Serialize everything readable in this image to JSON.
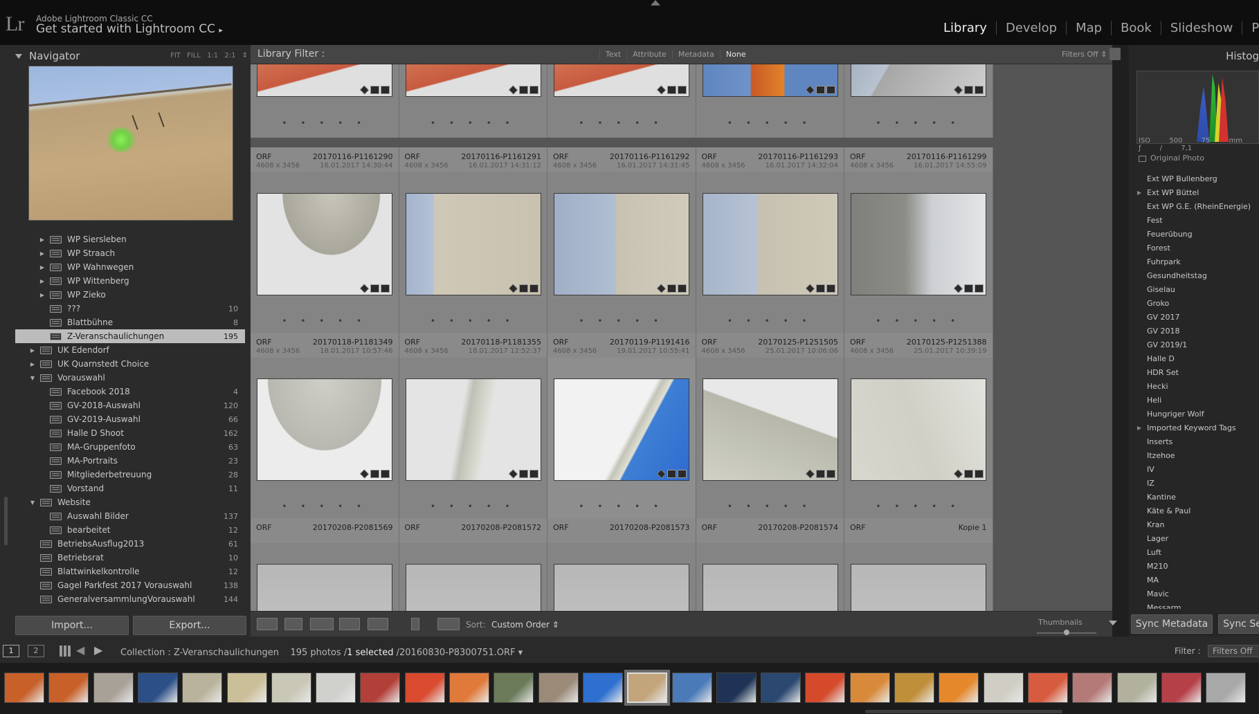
{
  "identity": {
    "app_name": "Adobe Lightroom Classic CC",
    "tagline": "Get started with Lightroom CC",
    "tagline_arrow": "▸",
    "logo": "Lr"
  },
  "modules": [
    "Library",
    "Develop",
    "Map",
    "Book",
    "Slideshow",
    "Prin"
  ],
  "active_module": "Library",
  "navigator": {
    "title": "Navigator",
    "options": "FIT FILL 1:1 2:1 ⇕"
  },
  "collections": [
    {
      "name": "WP Siersleben",
      "count": "",
      "level": 2,
      "expander": "▶"
    },
    {
      "name": "WP Straach",
      "count": "",
      "level": 2,
      "expander": "▶"
    },
    {
      "name": "WP Wahnwegen",
      "count": "",
      "level": 2,
      "expander": "▶"
    },
    {
      "name": "WP Wittenberg",
      "count": "",
      "level": 2,
      "expander": "▶"
    },
    {
      "name": "WP Zieko",
      "count": "",
      "level": 2,
      "expander": "▶"
    },
    {
      "name": "???",
      "count": "10",
      "level": 2,
      "expander": ""
    },
    {
      "name": "Blattbühne",
      "count": "8",
      "level": 2,
      "expander": ""
    },
    {
      "name": "Z-Veranschaulichungen",
      "count": "195",
      "level": 2,
      "expander": "",
      "selected": true
    },
    {
      "name": "UK Edendorf",
      "count": "",
      "level": 1,
      "expander": "▶"
    },
    {
      "name": "UK Quarnstedt Choice",
      "count": "",
      "level": 1,
      "expander": "▶"
    },
    {
      "name": "Vorauswahl",
      "count": "",
      "level": 1,
      "expander": "▼"
    },
    {
      "name": "Facebook 2018",
      "count": "4",
      "level": 2,
      "expander": ""
    },
    {
      "name": "GV-2018-Auswahl",
      "count": "120",
      "level": 2,
      "expander": ""
    },
    {
      "name": "GV-2019-Auswahl",
      "count": "66",
      "level": 2,
      "expander": ""
    },
    {
      "name": "Halle D Shoot",
      "count": "162",
      "level": 2,
      "expander": ""
    },
    {
      "name": "MA-Gruppenfoto",
      "count": "63",
      "level": 2,
      "expander": ""
    },
    {
      "name": "MA-Portraits",
      "count": "23",
      "level": 2,
      "expander": ""
    },
    {
      "name": "Mitgliederbetreuung",
      "count": "28",
      "level": 2,
      "expander": ""
    },
    {
      "name": "Vorstand",
      "count": "11",
      "level": 2,
      "expander": ""
    },
    {
      "name": "Website",
      "count": "",
      "level": 1,
      "expander": "▼"
    },
    {
      "name": "Auswahl Bilder",
      "count": "137",
      "level": 2,
      "expander": ""
    },
    {
      "name": "bearbeitet",
      "count": "12",
      "level": 2,
      "expander": ""
    },
    {
      "name": "BetriebsAusflug2013",
      "count": "61",
      "level": 1,
      "expander": ""
    },
    {
      "name": "Betriebsrat",
      "count": "10",
      "level": 1,
      "expander": ""
    },
    {
      "name": "Blattwinkelkontrolle",
      "count": "12",
      "level": 1,
      "expander": ""
    },
    {
      "name": "Gagel Parkfest 2017 Vorauswahl",
      "count": "138",
      "level": 1,
      "expander": ""
    },
    {
      "name": "GeneralversammlungVorauswahl",
      "count": "144",
      "level": 1,
      "expander": ""
    }
  ],
  "buttons": {
    "import": "Import...",
    "export": "Export...",
    "sync_metadata": "Sync Metadata",
    "sync_settings": "Sync Se"
  },
  "library_filter": {
    "label": "Library Filter :",
    "options": [
      "Text",
      "Attribute",
      "Metadata",
      "None"
    ],
    "active": "None",
    "filters_state": "Filters Off ⇕"
  },
  "grid": {
    "partial_row": [
      {
        "thumb": "t-orange"
      },
      {
        "thumb": "t-orange"
      },
      {
        "thumb": "t-orange"
      },
      {
        "thumb": "t-blueorange"
      },
      {
        "thumb": "t-greyblade"
      }
    ],
    "rows": [
      [
        {
          "ext": "ORF",
          "file": "20170116-P1161290",
          "dims": "4608 x 3456",
          "date": "16.01.2017 14:30:44",
          "thumb": "t-bladetip"
        },
        {
          "ext": "ORF",
          "file": "20170116-P1161291",
          "dims": "4608 x 3456",
          "date": "16.01.2017 14:31:12",
          "thumb": "t-bladeside"
        },
        {
          "ext": "ORF",
          "file": "20170116-P1161292",
          "dims": "4608 x 3456",
          "date": "16.01.2017 14:31:45",
          "thumb": "t-bladeside2"
        },
        {
          "ext": "ORF",
          "file": "20170116-P1161293",
          "dims": "4608 x 3456",
          "date": "16.01.2017 14:32:04",
          "thumb": "t-bladeside3"
        },
        {
          "ext": "ORF",
          "file": "20170116-P1161299",
          "dims": "4608 x 3456",
          "date": "16.01.2017 14:55:09",
          "thumb": "t-bladegrey"
        }
      ],
      [
        {
          "ext": "ORF",
          "file": "20170118-P1181349",
          "dims": "4608 x 3456",
          "date": "18.01.2017 10:57:46",
          "thumb": "t-bladetipdark"
        },
        {
          "ext": "ORF",
          "file": "20170118-P1181355",
          "dims": "4608 x 3456",
          "date": "18.01.2017 12:52:37",
          "thumb": "t-rod"
        },
        {
          "ext": "ORF",
          "file": "20170119-P1191416",
          "dims": "4608 x 3456",
          "date": "19.01.2017 10:55:41",
          "thumb": "t-rodblue"
        },
        {
          "ext": "ORF",
          "file": "20170125-P1251505",
          "dims": "4608 x 3456",
          "date": "25.01.2017 10:06:06",
          "thumb": "t-bladewide"
        },
        {
          "ext": "ORF",
          "file": "20170125-P1251388",
          "dims": "4608 x 3456",
          "date": "25.01.2017 10:39:19",
          "thumb": "t-bladepale"
        }
      ],
      [
        {
          "ext": "ORF",
          "file": "20170208-P2081569",
          "dims": "",
          "date": "",
          "thumb": "t-dark"
        },
        {
          "ext": "ORF",
          "file": "20170208-P2081572",
          "dims": "",
          "date": "",
          "thumb": "t-dark"
        },
        {
          "ext": "ORF",
          "file": "20170208-P2081573",
          "dims": "",
          "date": "",
          "thumb": "t-dark"
        },
        {
          "ext": "ORF",
          "file": "20170208-P2081574",
          "dims": "",
          "date": "",
          "thumb": "t-dark"
        },
        {
          "ext": "ORF",
          "file": "Kopie 1",
          "dims": "",
          "date": "",
          "thumb": "t-dark"
        }
      ]
    ],
    "rating_dots": "• • • • •"
  },
  "toolbar": {
    "sort_label": "Sort:",
    "sort_value": "Custom Order ⇕",
    "thumbnails_label": "Thumbnails",
    "thumbnail_size": 0.5
  },
  "histogram": {
    "title": "Histog",
    "iso": "ISO 500",
    "focal": "75 mm",
    "aperture": "ƒ / 7,1",
    "original_photo": "Original Photo"
  },
  "keywords": [
    {
      "name": "Ext WP Bullenberg",
      "expander": ""
    },
    {
      "name": "Ext WP Büttel",
      "expander": "▶"
    },
    {
      "name": "Ext WP G.E. (RheinEnergie)",
      "expander": ""
    },
    {
      "name": "Fest",
      "expander": ""
    },
    {
      "name": "Feuerübung",
      "expander": ""
    },
    {
      "name": "Forest",
      "expander": ""
    },
    {
      "name": "Fuhrpark",
      "expander": ""
    },
    {
      "name": "Gesundheitstag",
      "expander": ""
    },
    {
      "name": "Giselau",
      "expander": ""
    },
    {
      "name": "Groko",
      "expander": ""
    },
    {
      "name": "GV 2017",
      "expander": ""
    },
    {
      "name": "GV 2018",
      "expander": ""
    },
    {
      "name": "GV 2019/1",
      "expander": ""
    },
    {
      "name": "Halle D",
      "expander": ""
    },
    {
      "name": "HDR Set",
      "expander": ""
    },
    {
      "name": "Hecki",
      "expander": ""
    },
    {
      "name": "Heli",
      "expander": ""
    },
    {
      "name": "Hungriger Wolf",
      "expander": ""
    },
    {
      "name": "Imported Keyword Tags",
      "expander": "▶"
    },
    {
      "name": "Inserts",
      "expander": ""
    },
    {
      "name": "Itzehoe",
      "expander": ""
    },
    {
      "name": "IV",
      "expander": ""
    },
    {
      "name": "IZ",
      "expander": ""
    },
    {
      "name": "Kantine",
      "expander": ""
    },
    {
      "name": "Käte & Paul",
      "expander": ""
    },
    {
      "name": "Kran",
      "expander": ""
    },
    {
      "name": "Lager",
      "expander": ""
    },
    {
      "name": "Luft",
      "expander": ""
    },
    {
      "name": "M210",
      "expander": ""
    },
    {
      "name": "MA",
      "expander": ""
    },
    {
      "name": "Mavic",
      "expander": ""
    },
    {
      "name": "Messarm",
      "expander": ""
    }
  ],
  "filmstrip": {
    "view1": "1",
    "view2": "2",
    "collection_prefix": "Collection : ",
    "collection": "Z-Veranschaulichungen",
    "photo_count": "195 photos /",
    "selected": "1 selected",
    "file": "/20160830-P8300751.ORF ▾",
    "filter_label": "Filter :",
    "filter_value": "Filters Off",
    "thumbs": [
      "#c8602a",
      "#c8602a",
      "#a8a198",
      "#2b4f86",
      "#b9b39b",
      "#cbbf9a",
      "#c9c7b6",
      "#d0d0cc",
      "#b24038",
      "#d94a2f",
      "#e07a3a",
      "#6b7b5a",
      "#9b8a78",
      "#2e6fd0",
      "#c2a57b",
      "#4a7ab8",
      "#1e3355",
      "#2a4870",
      "#d44a2a",
      "#d88a3a",
      "#c08f3a",
      "#e5882b",
      "#cfcdc4",
      "#d75b3e",
      "#b47a78",
      "#b1b19e",
      "#b64048",
      "#a8a8a8"
    ],
    "selected_index": 14
  }
}
